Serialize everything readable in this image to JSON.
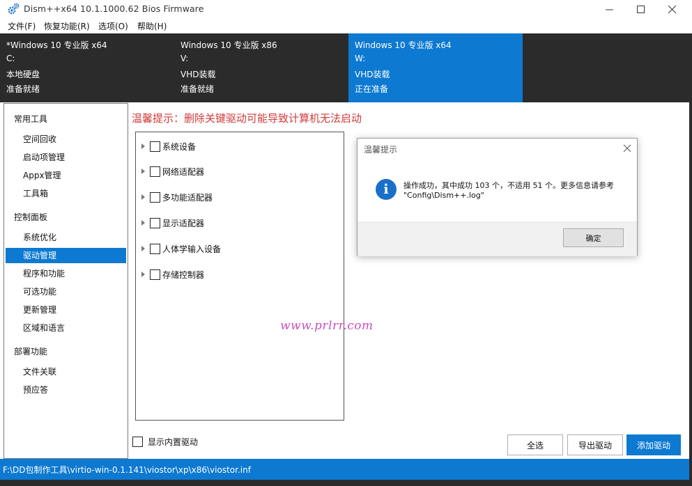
{
  "window": {
    "title": "Dism++x64 10.1.1000.62 Bios Firmware",
    "icons": {
      "app": "gears-icon",
      "minimize": "minimize-icon",
      "maximize": "maximize-icon",
      "close": "close-icon"
    }
  },
  "menu": [
    "文件(F)",
    "恢复功能(R)",
    "选项(O)",
    "帮助(H)"
  ],
  "images": [
    {
      "name": "*Windows 10 专业版 x64",
      "drive": "C:",
      "type": "本地硬盘",
      "status": "准备就绪",
      "selected": false
    },
    {
      "name": "Windows 10 专业版 x86",
      "drive": "V:",
      "type": "VHD装载",
      "status": "准备就绪",
      "selected": false
    },
    {
      "name": "Windows 10 专业版 x64",
      "drive": "W:",
      "type": "VHD装载",
      "status": "正在准备",
      "selected": true
    }
  ],
  "sidebar": {
    "categories": [
      {
        "label": "常用工具",
        "items": [
          "空间回收",
          "启动项管理",
          "Appx管理",
          "工具箱"
        ]
      },
      {
        "label": "控制面板",
        "items": [
          "系统优化",
          "驱动管理",
          "程序和功能",
          "可选功能",
          "更新管理",
          "区域和语言"
        ]
      },
      {
        "label": "部署功能",
        "items": [
          "文件关联",
          "预应答"
        ]
      }
    ],
    "active_item": "驱动管理"
  },
  "main": {
    "warning": "温馨提示：删除关键驱动可能导致计算机无法启动",
    "tree": [
      "系统设备",
      "网络适配器",
      "多功能适配器",
      "显示适配器",
      "人体学输入设备",
      "存储控制器"
    ],
    "show_builtin_label": "显示内置驱动",
    "buttons": {
      "select_all": "全选",
      "export": "导出驱动",
      "add": "添加驱动"
    },
    "watermark": "www.prlrr.com"
  },
  "dialog": {
    "title": "温馨提示",
    "message_line1": "操作成功，其中成功 103 个，不适用 51 个。更多信息请参考",
    "message_line2": "\"Config\\Dism++.log\"",
    "ok_label": "确定",
    "icon": "info-icon"
  },
  "status_bar": {
    "path": "F:\\DD包制作工具\\virtio-win-0.1.141\\viostor\\xp\\x86\\viostor.inf"
  },
  "colors": {
    "accent": "#0d79d1",
    "dark_bar": "#2b2b2b",
    "warning": "#d13a3a",
    "watermark": "#c84fc4"
  }
}
